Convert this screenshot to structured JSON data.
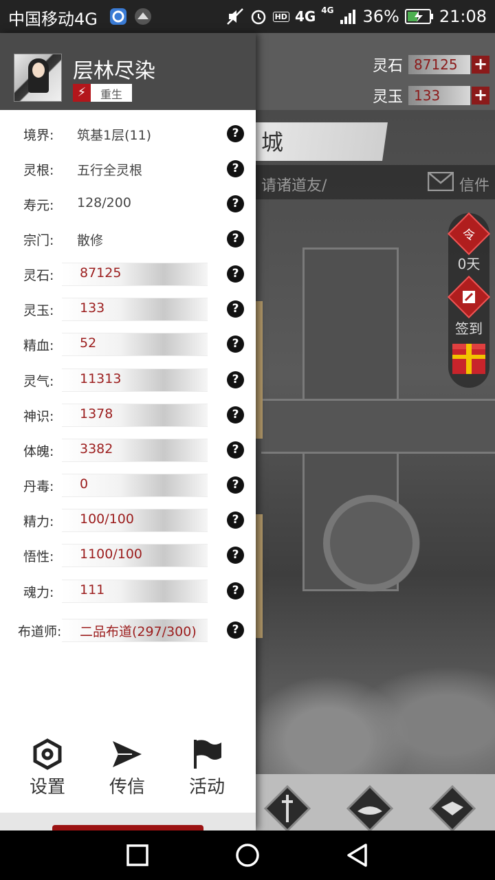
{
  "status_bar": {
    "carrier": "中国移动4G",
    "hd": "HD",
    "network": "4G",
    "network_small": "4G",
    "battery": "36%",
    "time": "21:08"
  },
  "header": {
    "player_name": "层林尽染",
    "badge_label": "重生"
  },
  "resources": [
    {
      "label": "灵石",
      "value": "87125"
    },
    {
      "label": "灵玉",
      "value": "133"
    }
  ],
  "city": {
    "name_partial": "城",
    "mail_placeholder": "请诸道友/",
    "mail_label": "信件"
  },
  "side": {
    "token_glyph": "令",
    "days": "0天",
    "checkin": "签到"
  },
  "stats": [
    {
      "label": "境界:",
      "value": "筑基1层(11)",
      "style": "plain"
    },
    {
      "label": "灵根:",
      "value": "五行全灵根",
      "style": "plain"
    },
    {
      "label": "寿元:",
      "value": "128/200",
      "style": "plain"
    },
    {
      "label": "宗门:",
      "value": "散修",
      "style": "plain"
    },
    {
      "label": "灵石:",
      "value": "87125",
      "style": "bar"
    },
    {
      "label": "灵玉:",
      "value": "133",
      "style": "bar"
    },
    {
      "label": "精血:",
      "value": "52",
      "style": "bar"
    },
    {
      "label": "灵气:",
      "value": "11313",
      "style": "bar"
    },
    {
      "label": "神识:",
      "value": "1378",
      "style": "bar"
    },
    {
      "label": "体魄:",
      "value": "3382",
      "style": "bar"
    },
    {
      "label": "丹毒:",
      "value": "0",
      "style": "bar"
    },
    {
      "label": "精力:",
      "value": "100/100",
      "style": "bar"
    },
    {
      "label": "悟性:",
      "value": "1100/100",
      "style": "bar"
    },
    {
      "label": "魂力:",
      "value": "111",
      "style": "bar"
    },
    {
      "label": "布道师:",
      "value": "二品布道(297/300)",
      "style": "bar"
    }
  ],
  "help_glyph": "?",
  "plus_glyph": "+",
  "footer": {
    "settings": "设置",
    "message": "传信",
    "activity": "活动"
  }
}
